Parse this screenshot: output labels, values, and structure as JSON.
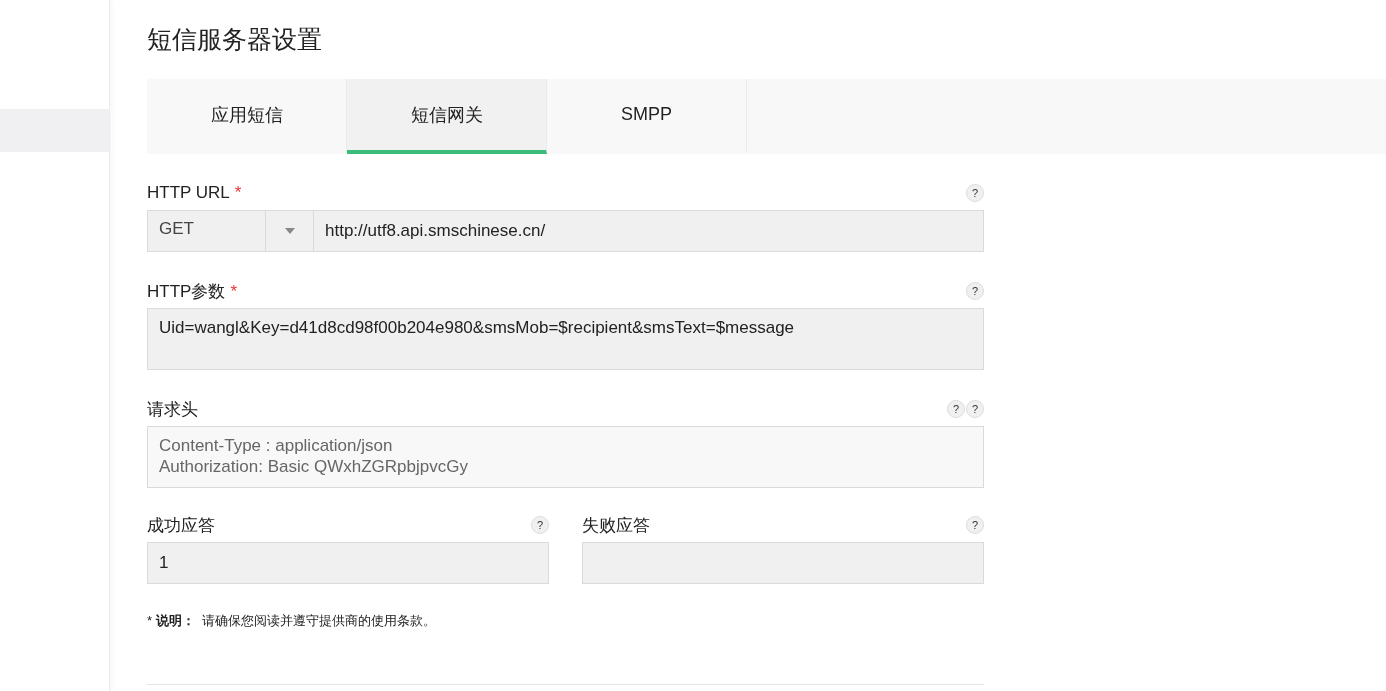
{
  "title": "短信服务器设置",
  "tabs": [
    {
      "label": "应用短信",
      "selected": false
    },
    {
      "label": "短信网关",
      "selected": true
    },
    {
      "label": "SMPP",
      "selected": false
    }
  ],
  "http_url": {
    "label": "HTTP URL",
    "required_mark": "*",
    "help": "?",
    "method": "GET",
    "value": "http://utf8.api.smschinese.cn/"
  },
  "http_params": {
    "label": "HTTP参数",
    "required_mark": "*",
    "help": "?",
    "value": "Uid=wangl&Key=d41d8cd98f00b204e980&smsMob=$recipient&smsText=$message"
  },
  "headers": {
    "label": "请求头",
    "help": [
      "?",
      "?"
    ],
    "placeholder": "Content-Type : application/json\nAuthorization: Basic QWxhZGRpbjpvcGy"
  },
  "responses": [
    {
      "label": "成功应答",
      "help": "?",
      "value": "1"
    },
    {
      "label": "失败应答",
      "help": "?"
    }
  ],
  "note": "* **说明：**  请确保您阅读并遵守提供商的使用条款。"
}
